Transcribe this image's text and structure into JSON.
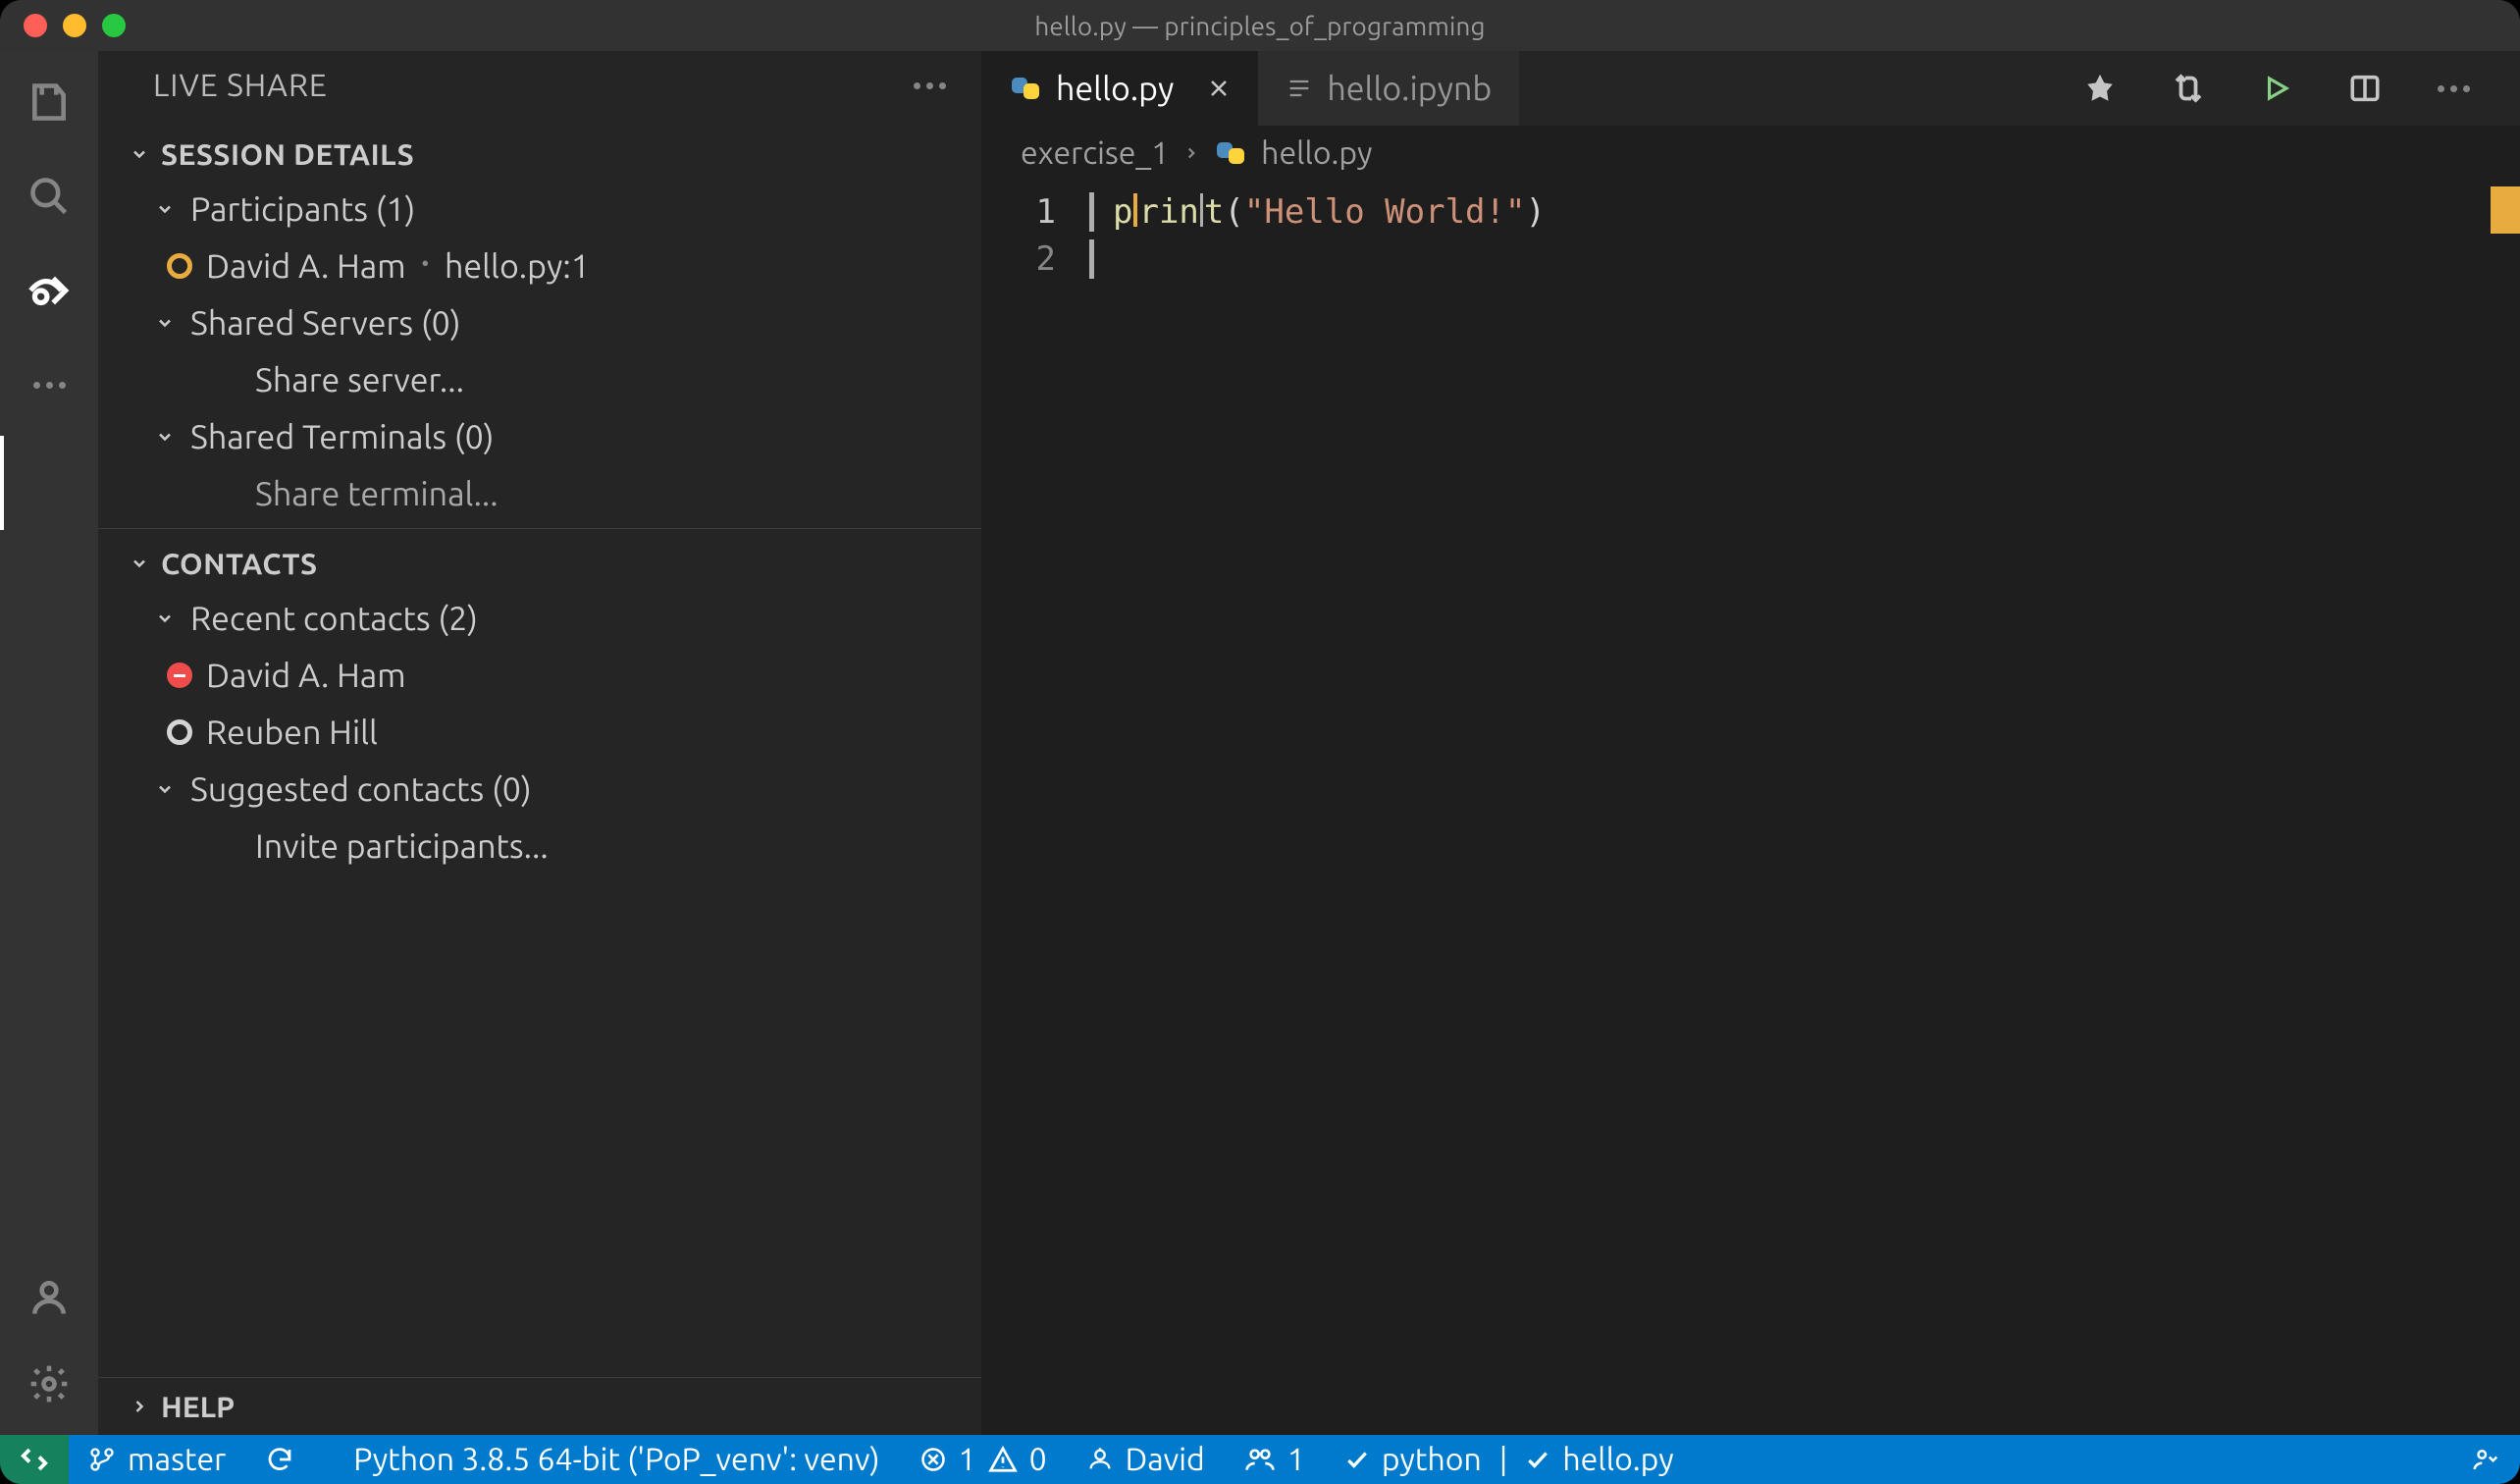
{
  "titlebar": "hello.py — principles_of_programming",
  "sidebar": {
    "title": "LIVE SHARE",
    "sessionDetails": {
      "header": "SESSION DETAILS",
      "participants": {
        "label": "Participants (1)",
        "name": "David A. Ham",
        "location": "hello.py:1"
      },
      "sharedServers": {
        "label": "Shared Servers (0)",
        "action": "Share server..."
      },
      "sharedTerminals": {
        "label": "Shared Terminals (0)",
        "action": "Share terminal..."
      }
    },
    "contacts": {
      "header": "CONTACTS",
      "recent": {
        "label": "Recent contacts (2)",
        "items": [
          "David A. Ham",
          "Reuben Hill"
        ]
      },
      "suggested": {
        "label": "Suggested contacts (0)",
        "action": "Invite participants..."
      }
    },
    "help": "HELP"
  },
  "tabs": {
    "active": "hello.py",
    "inactive": "hello.ipynb"
  },
  "breadcrumb": {
    "folder": "exercise_1",
    "file": "hello.py"
  },
  "code": {
    "line1": {
      "fn": "print",
      "open": "(",
      "str": "\"Hello World!\"",
      "close": ")"
    },
    "lineNumbers": [
      "1",
      "2"
    ]
  },
  "statusbar": {
    "branch": "master",
    "python": "Python 3.8.5 64-bit ('PoP_venv': venv)",
    "errors": "1",
    "warnings": "0",
    "liveshareUser": "David",
    "liveshareCount": "1",
    "check1": "python",
    "check2": "hello.py",
    "sep": "|"
  }
}
